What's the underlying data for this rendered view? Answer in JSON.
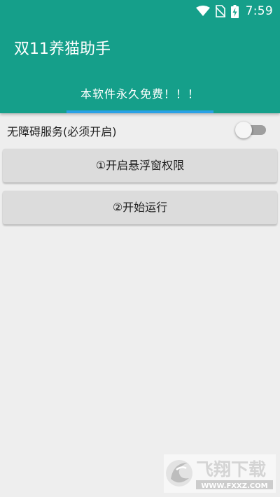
{
  "status_bar": {
    "time": "7:59",
    "icons": [
      "wifi-icon",
      "no-sim-icon",
      "battery-charging-icon"
    ]
  },
  "app_bar": {
    "title": "双11养猫助手",
    "tab_label": "本软件永久免费！！！"
  },
  "accessibility_switch": {
    "label": "无障碍服务(必须开启)",
    "checked": false
  },
  "buttons": {
    "overlay_permission": "①开启悬浮窗权限",
    "start": "②开始运行"
  },
  "watermark": {
    "brand": "飞翔下载",
    "site": "WWW.FXXZ.COM"
  },
  "colors": {
    "primary": "#159f8a",
    "tab_indicator": "#2aa1e6",
    "background": "#eeeeee",
    "button": "#dcdcdc"
  }
}
